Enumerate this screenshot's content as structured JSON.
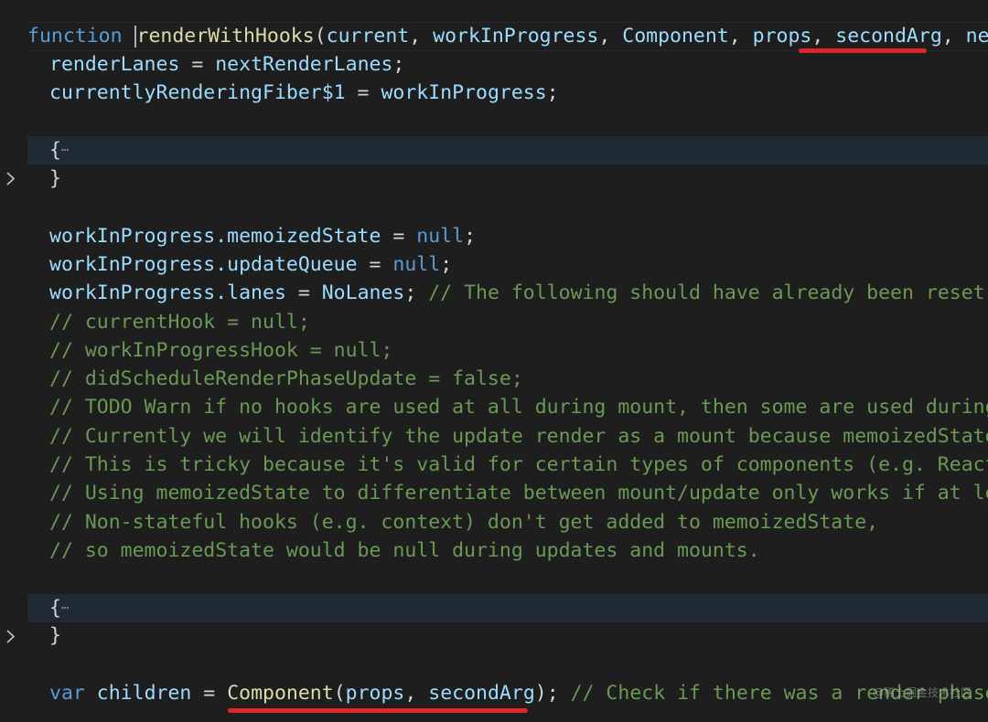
{
  "code": {
    "l1": {
      "keyword": "function",
      "fname": "renderWithHooks",
      "open": "(",
      "a1": "current",
      "s1": ", ",
      "a2": "workInProgress",
      "s2": ", ",
      "a3": "Component",
      "s3": ", ",
      "a4": "props",
      "s4": ", ",
      "a5": "secondArg",
      "s5": ", ",
      "a6": "nextRenderLanes"
    },
    "l2": {
      "lhs": "renderLanes",
      "op": " = ",
      "rhs": "nextRenderLanes",
      "end": ";"
    },
    "l3": {
      "lhs": "currentlyRenderingFiber$1",
      "op": " = ",
      "rhs": "workInProgress",
      "end": ";"
    },
    "l5": {
      "brace": "{"
    },
    "l6": {
      "brace": "}"
    },
    "l8": {
      "obj": "workInProgress",
      "prop": ".memoizedState",
      "op": " = ",
      "val": "null",
      "end": ";"
    },
    "l9": {
      "obj": "workInProgress",
      "prop": ".updateQueue",
      "op": " = ",
      "val": "null",
      "end": ";"
    },
    "l10": {
      "obj": "workInProgress",
      "prop": ".lanes",
      "op": " = ",
      "val": "NoLanes",
      "end": "; ",
      "comment": "// The following should have already been reset"
    },
    "comments": [
      "// currentHook = null;",
      "// workInProgressHook = null;",
      "// didScheduleRenderPhaseUpdate = false;",
      "// TODO Warn if no hooks are used at all during mount, then some are used during update.",
      "// Currently we will identify the update render as a mount because memoizedState === null.",
      "// This is tricky because it's valid for certain types of components (e.g. React.lazy)",
      "// Using memoizedState to differentiate between mount/update only works if at least one stateful hook is used.",
      "// Non-stateful hooks (e.g. context) don't get added to memoizedState,",
      "// so memoizedState would be null during updates and mounts."
    ],
    "l21": {
      "brace": "{"
    },
    "l22": {
      "brace": "}"
    },
    "l24": {
      "keyword": "var",
      "name": " children",
      "op": " = ",
      "fn": "Component",
      "open": "(",
      "a1": "props",
      "sep": ", ",
      "a2": "secondArg",
      "close": ");",
      "comment": " // Check if there was a render phase update"
    }
  },
  "watermark": "@稀土掘金技术社区",
  "colors": {
    "keyword": "#569cd6",
    "function": "#dcdcaa",
    "variable": "#9cdcfe",
    "comment": "#6a9955",
    "punctuation": "#d4d4d4",
    "highlight": "#e0262b"
  }
}
